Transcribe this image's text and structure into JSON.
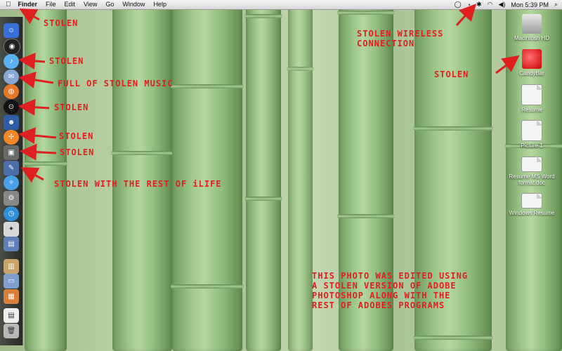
{
  "menubar": {
    "apple_label": "",
    "items": [
      "Finder",
      "File",
      "Edit",
      "View",
      "Go",
      "Window",
      "Help"
    ],
    "clock": "Mon 5:39 PM"
  },
  "dock": {
    "icons": [
      "finder-icon",
      "dashboard-icon",
      "itunes-icon",
      "firefox-icon",
      "pinwheel-icon",
      "person-icon",
      "vlc-icon",
      "photo-icon",
      "preview-icon",
      "ical-icon",
      "safari-icon",
      "terminal-icon",
      "timemachine-icon",
      "gamecontrol-icon",
      "pencil-icon",
      "utilities-icon",
      "folder-icon",
      "downloads-icon",
      "box-icon",
      "stack-icon",
      "trash-icon"
    ]
  },
  "desktop": {
    "icons": [
      {
        "label": "Macintosh HD",
        "icon": "hard-disk-icon"
      },
      {
        "label": "CandyBar",
        "icon": "candybar-icon"
      },
      {
        "label": "Resume",
        "icon": "pages-doc-icon"
      },
      {
        "label": "Picture 1",
        "icon": "png-icon"
      },
      {
        "label": "Resume MS Word format.doc",
        "icon": "doc-icon"
      },
      {
        "label": "Windows Resume",
        "icon": "doc-icon"
      }
    ]
  },
  "annotations": {
    "a1": "STOLEN",
    "a2": "STOLEN",
    "a3": "FULL OF STOLEN MUSIC",
    "a4": "STOLEN",
    "a5": "STOLEN",
    "a6": "STOLEN",
    "a7": "STOLEN WITH THE REST OF iLIFE",
    "wireless": "STOLEN WIRELESS\nCONNECTION",
    "candybar": "STOLEN",
    "photoshop": "THIS PHOTO WAS EDITED USING\nA STOLEN VERSION OF ADOBE\nPHOTOSHOP ALONG WITH THE\nREST OF ADOBES PROGRAMS"
  },
  "colors": {
    "annotation": "#e02020",
    "dock": "#2a2a2a"
  }
}
